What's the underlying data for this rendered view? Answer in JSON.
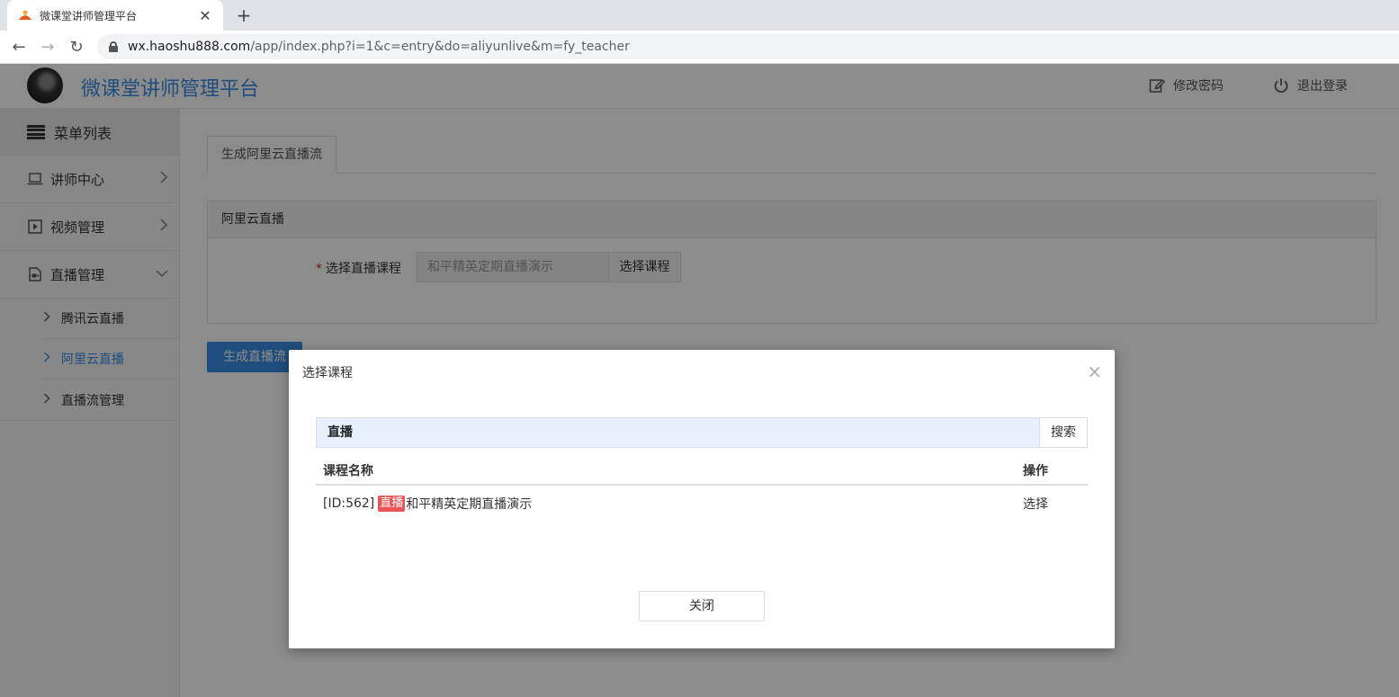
{
  "browser": {
    "tab_title": "微课堂讲师管理平台",
    "url_host": "wx.haoshu888.com",
    "url_path": "/app/index.php?i=1&c=entry&do=aliyunlive&m=fy_teacher"
  },
  "header": {
    "app_title": "微课堂讲师管理平台",
    "change_password": "修改密码",
    "logout": "退出登录"
  },
  "sidebar": {
    "menu_head": "菜单列表",
    "items": [
      {
        "label": "讲师中心",
        "icon": "laptop-icon",
        "chevron": "›"
      },
      {
        "label": "视频管理",
        "icon": "video-icon",
        "chevron": "›"
      },
      {
        "label": "直播管理",
        "icon": "live-icon",
        "chevron": "⌄"
      }
    ],
    "sub_items": [
      {
        "label": "腾讯云直播",
        "active": false
      },
      {
        "label": "阿里云直播",
        "active": true
      },
      {
        "label": "直播流管理",
        "active": false
      }
    ]
  },
  "main": {
    "tab_label": "生成阿里云直播流",
    "panel_title": "阿里云直播",
    "form_label": "选择直播课程",
    "required_mark": "*",
    "course_value": "和平精英定期直播演示",
    "choose_course_btn": "选择课程",
    "generate_btn": "生成直播流"
  },
  "modal": {
    "title": "选择课程",
    "close_glyph": "×",
    "search_value": "直播",
    "search_btn": "搜索",
    "col_name": "课程名称",
    "col_action": "操作",
    "rows": [
      {
        "id_text": "[ID:562]",
        "badge": "直播",
        "name": "和平精英定期直播演示",
        "action": "选择"
      }
    ],
    "close_btn": "关闭"
  },
  "colors": {
    "accent": "#3a8ee6",
    "badge": "#e85555"
  }
}
